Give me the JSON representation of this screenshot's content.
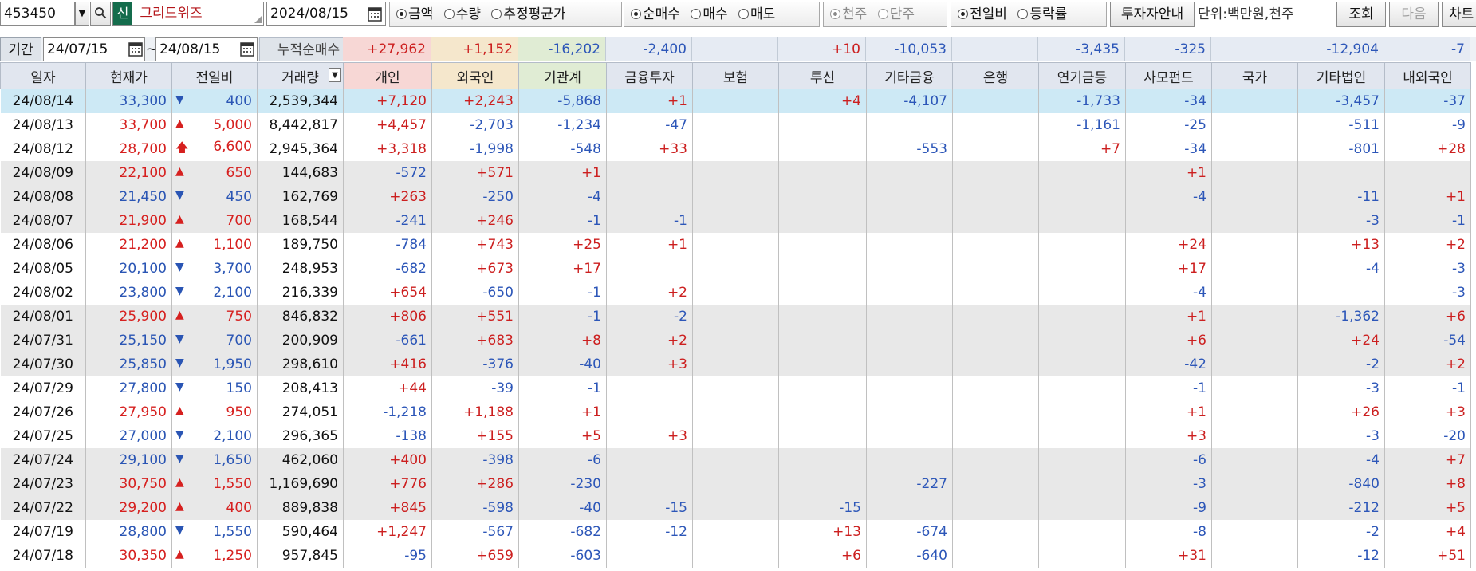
{
  "toolbar": {
    "code": "453450",
    "new_badge": "신",
    "stock_name": "그리드위즈",
    "date": "2024/08/15",
    "type_options": [
      "금액",
      "수량",
      "추정평균가"
    ],
    "trade_options": [
      "순매수",
      "매수",
      "매도"
    ],
    "unit_options": [
      "천주",
      "단주"
    ],
    "compare_options": [
      "전일비",
      "등락률"
    ],
    "investor_info_button": "투자자안내",
    "unit_label": "단위:백만원,천주",
    "search_button": "조회",
    "next_button": "다음",
    "chart_button": "차트"
  },
  "period": {
    "label": "기간",
    "start": "24/07/15",
    "tilde": "~",
    "end": "24/08/15",
    "sum_label": "누적순매수",
    "sums": [
      "+27,962",
      "+1,152",
      "-16,202",
      "-2,400",
      "",
      "+10",
      "-10,053",
      "",
      "-3,435",
      "-325",
      "",
      "-12,904",
      "-7"
    ]
  },
  "table": {
    "headers": [
      "일자",
      "현재가",
      "전일비",
      "거래량",
      "개인",
      "외국인",
      "기관계",
      "금융투자",
      "보험",
      "투신",
      "기타금융",
      "은행",
      "연기금등",
      "사모펀드",
      "국가",
      "기타법인",
      "내외국인"
    ],
    "rows": [
      {
        "date": "24/08/14",
        "price": "33,300",
        "dir": "down",
        "change": "400",
        "volume": "2,539,344",
        "vals": [
          "+7,120",
          "+2,243",
          "-5,868",
          "+1",
          "",
          "+4",
          "-4,107",
          "",
          "-1,733",
          "-34",
          "",
          "-3,457",
          "-37"
        ]
      },
      {
        "date": "24/08/13",
        "price": "33,700",
        "dir": "up",
        "change": "5,000",
        "volume": "8,442,817",
        "vals": [
          "+4,457",
          "-2,703",
          "-1,234",
          "-47",
          "",
          "",
          "",
          "",
          "-1,161",
          "-25",
          "",
          "-511",
          "-9"
        ]
      },
      {
        "date": "24/08/12",
        "price": "28,700",
        "dir": "limit",
        "change": "6,600",
        "volume": "2,945,364",
        "vals": [
          "+3,318",
          "-1,998",
          "-548",
          "+33",
          "",
          "",
          "-553",
          "",
          "+7",
          "-34",
          "",
          "-801",
          "+28"
        ]
      },
      {
        "date": "24/08/09",
        "price": "22,100",
        "dir": "up",
        "change": "650",
        "volume": "144,683",
        "vals": [
          "-572",
          "+571",
          "+1",
          "",
          "",
          "",
          "",
          "",
          "",
          "+1",
          "",
          "",
          ""
        ]
      },
      {
        "date": "24/08/08",
        "price": "21,450",
        "dir": "down",
        "change": "450",
        "volume": "162,769",
        "vals": [
          "+263",
          "-250",
          "-4",
          "",
          "",
          "",
          "",
          "",
          "",
          "-4",
          "",
          "-11",
          "+1"
        ]
      },
      {
        "date": "24/08/07",
        "price": "21,900",
        "dir": "up",
        "change": "700",
        "volume": "168,544",
        "vals": [
          "-241",
          "+246",
          "-1",
          "-1",
          "",
          "",
          "",
          "",
          "",
          "",
          "",
          "-3",
          "-1"
        ]
      },
      {
        "date": "24/08/06",
        "price": "21,200",
        "dir": "up",
        "change": "1,100",
        "volume": "189,750",
        "vals": [
          "-784",
          "+743",
          "+25",
          "+1",
          "",
          "",
          "",
          "",
          "",
          "+24",
          "",
          "+13",
          "+2"
        ]
      },
      {
        "date": "24/08/05",
        "price": "20,100",
        "dir": "down",
        "change": "3,700",
        "volume": "248,953",
        "vals": [
          "-682",
          "+673",
          "+17",
          "",
          "",
          "",
          "",
          "",
          "",
          "+17",
          "",
          "-4",
          "-3"
        ]
      },
      {
        "date": "24/08/02",
        "price": "23,800",
        "dir": "down",
        "change": "2,100",
        "volume": "216,339",
        "vals": [
          "+654",
          "-650",
          "-1",
          "+2",
          "",
          "",
          "",
          "",
          "",
          "-4",
          "",
          "",
          "-3"
        ]
      },
      {
        "date": "24/08/01",
        "price": "25,900",
        "dir": "up",
        "change": "750",
        "volume": "846,832",
        "vals": [
          "+806",
          "+551",
          "-1",
          "-2",
          "",
          "",
          "",
          "",
          "",
          "+1",
          "",
          "-1,362",
          "+6"
        ]
      },
      {
        "date": "24/07/31",
        "price": "25,150",
        "dir": "down",
        "change": "700",
        "volume": "200,909",
        "vals": [
          "-661",
          "+683",
          "+8",
          "+2",
          "",
          "",
          "",
          "",
          "",
          "+6",
          "",
          "+24",
          "-54"
        ]
      },
      {
        "date": "24/07/30",
        "price": "25,850",
        "dir": "down",
        "change": "1,950",
        "volume": "298,610",
        "vals": [
          "+416",
          "-376",
          "-40",
          "+3",
          "",
          "",
          "",
          "",
          "",
          "-42",
          "",
          "-2",
          "+2"
        ]
      },
      {
        "date": "24/07/29",
        "price": "27,800",
        "dir": "down",
        "change": "150",
        "volume": "208,413",
        "vals": [
          "+44",
          "-39",
          "-1",
          "",
          "",
          "",
          "",
          "",
          "",
          "-1",
          "",
          "-3",
          "-1"
        ]
      },
      {
        "date": "24/07/26",
        "price": "27,950",
        "dir": "up",
        "change": "950",
        "volume": "274,051",
        "vals": [
          "-1,218",
          "+1,188",
          "+1",
          "",
          "",
          "",
          "",
          "",
          "",
          "+1",
          "",
          "+26",
          "+3"
        ]
      },
      {
        "date": "24/07/25",
        "price": "27,000",
        "dir": "down",
        "change": "2,100",
        "volume": "296,365",
        "vals": [
          "-138",
          "+155",
          "+5",
          "+3",
          "",
          "",
          "",
          "",
          "",
          "+3",
          "",
          "-3",
          "-20"
        ]
      },
      {
        "date": "24/07/24",
        "price": "29,100",
        "dir": "down",
        "change": "1,650",
        "volume": "462,060",
        "vals": [
          "+400",
          "-398",
          "-6",
          "",
          "",
          "",
          "",
          "",
          "",
          "-6",
          "",
          "-4",
          "+7"
        ]
      },
      {
        "date": "24/07/23",
        "price": "30,750",
        "dir": "up",
        "change": "1,550",
        "volume": "1,169,690",
        "vals": [
          "+776",
          "+286",
          "-230",
          "",
          "",
          "",
          "-227",
          "",
          "",
          "-3",
          "",
          "-840",
          "+8"
        ]
      },
      {
        "date": "24/07/22",
        "price": "29,200",
        "dir": "up",
        "change": "400",
        "volume": "889,838",
        "vals": [
          "+845",
          "-598",
          "-40",
          "-15",
          "",
          "-15",
          "",
          "",
          "",
          "-9",
          "",
          "-212",
          "+5"
        ]
      },
      {
        "date": "24/07/19",
        "price": "28,800",
        "dir": "down",
        "change": "1,550",
        "volume": "590,464",
        "vals": [
          "+1,247",
          "-567",
          "-682",
          "-12",
          "",
          "+13",
          "-674",
          "",
          "",
          "-8",
          "",
          "-2",
          "+4"
        ]
      },
      {
        "date": "24/07/18",
        "price": "30,350",
        "dir": "up",
        "change": "1,250",
        "volume": "957,845",
        "vals": [
          "-95",
          "+659",
          "-603",
          "",
          "",
          "+6",
          "-640",
          "",
          "",
          "+31",
          "",
          "-12",
          "+51"
        ]
      }
    ]
  },
  "colors": {
    "up": "#d6201f",
    "down": "#2a55b4",
    "selected_row": "#cde9f5",
    "gray_row": "#e8e8e8",
    "header_bg": "#e1e6ef"
  }
}
